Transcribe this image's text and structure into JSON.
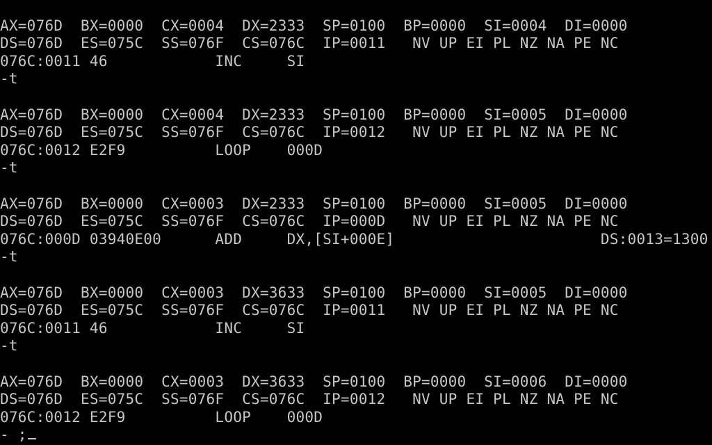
{
  "terminal": {
    "lines": [
      "AX=076D  BX=0000  CX=0004  DX=2333  SP=0100  BP=0000  SI=0004  DI=0000",
      "DS=076D  ES=075C  SS=076F  CS=076C  IP=0011   NV UP EI PL NZ NA PE NC",
      "076C:0011 46            INC     SI",
      "-t",
      "",
      "AX=076D  BX=0000  CX=0004  DX=2333  SP=0100  BP=0000  SI=0005  DI=0000",
      "DS=076D  ES=075C  SS=076F  CS=076C  IP=0012   NV UP EI PL NZ NA PE NC",
      "076C:0012 E2F9          LOOP    000D",
      "-t",
      "",
      "AX=076D  BX=0000  CX=0003  DX=2333  SP=0100  BP=0000  SI=0005  DI=0000",
      "DS=076D  ES=075C  SS=076F  CS=076C  IP=000D   NV UP EI PL NZ NA PE NC",
      "076C:000D 03940E00      ADD     DX,[SI+000E]                       DS:0013=1300",
      "-t",
      "",
      "AX=076D  BX=0000  CX=0003  DX=3633  SP=0100  BP=0000  SI=0005  DI=0000",
      "DS=076D  ES=075C  SS=076F  CS=076C  IP=0011   NV UP EI PL NZ NA PE NC",
      "076C:0011 46            INC     SI",
      "-t",
      "",
      "AX=076D  BX=0000  CX=0003  DX=3633  SP=0100  BP=0000  SI=0006  DI=0000",
      "DS=076D  ES=075C  SS=076F  CS=076C  IP=0012   NV UP EI PL NZ NA PE NC",
      "076C:0012 E2F9          LOOP    000D"
    ],
    "prompt": "- ;",
    "colors": {
      "background": "#000000",
      "foreground": "#c6c6c6"
    }
  }
}
